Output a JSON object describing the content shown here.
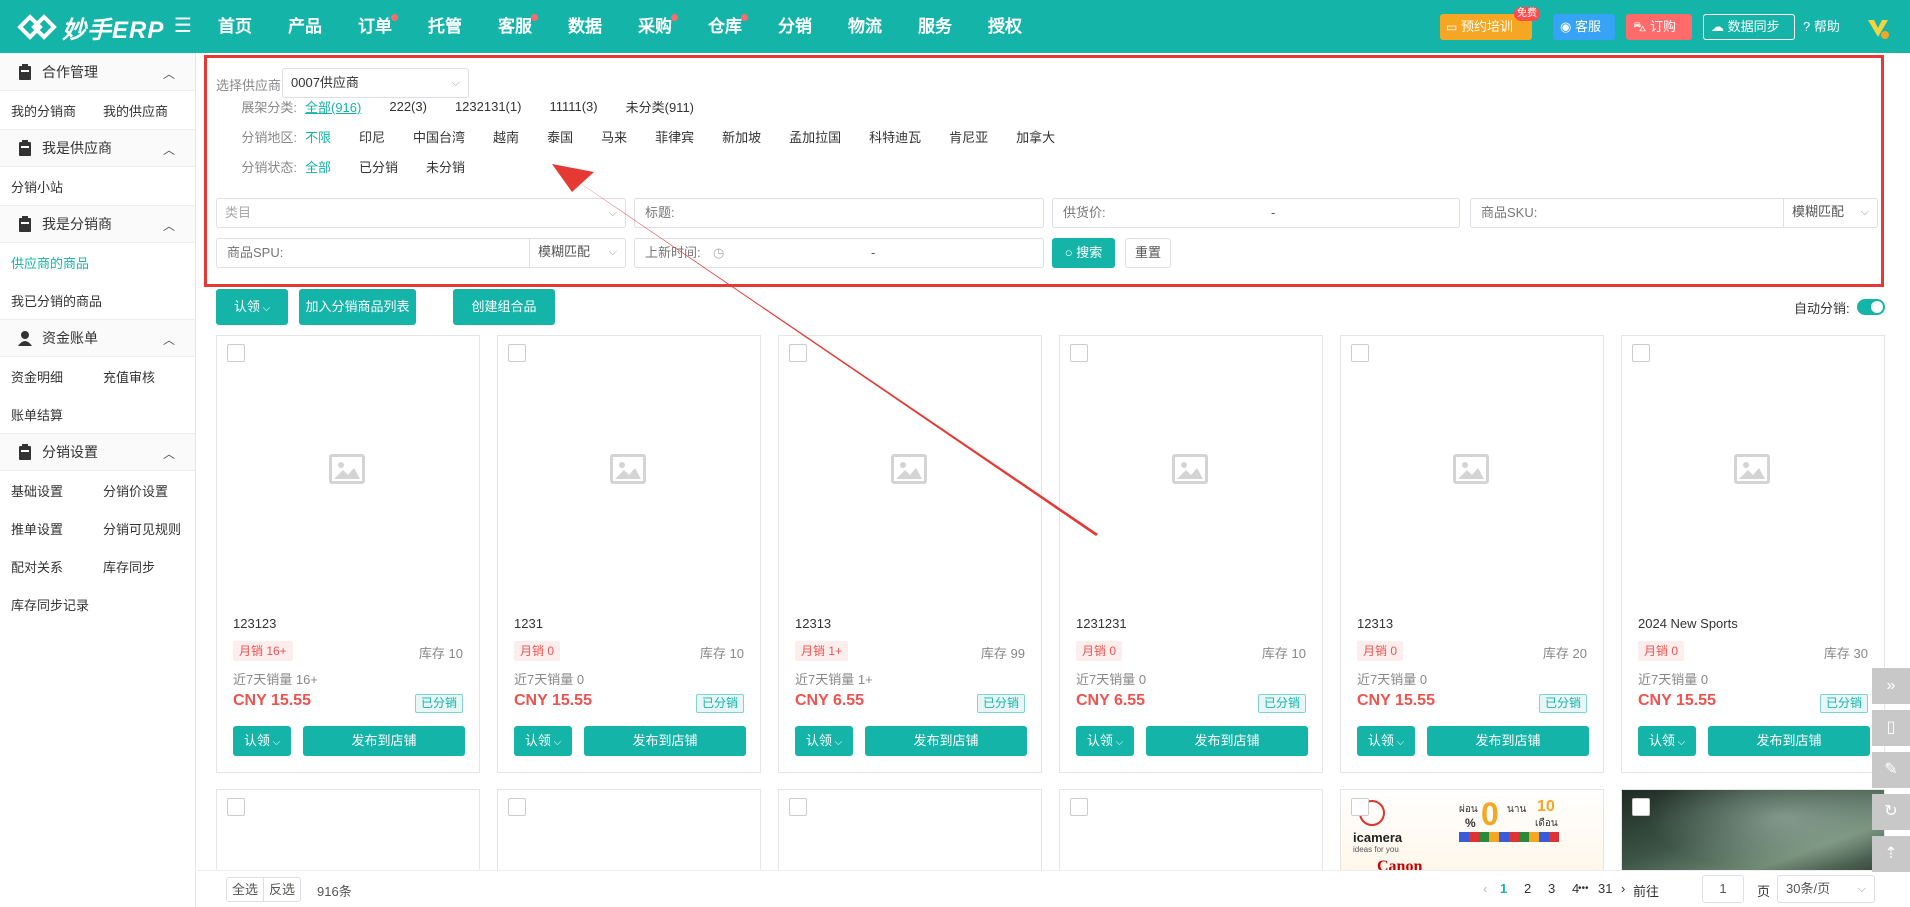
{
  "header": {
    "logo_text": "妙手ERP",
    "nav": [
      {
        "label": "首页",
        "dot": false
      },
      {
        "label": "产品",
        "dot": false
      },
      {
        "label": "订单",
        "dot": true
      },
      {
        "label": "托管",
        "dot": false
      },
      {
        "label": "客服",
        "dot": true
      },
      {
        "label": "数据",
        "dot": false
      },
      {
        "label": "采购",
        "dot": true
      },
      {
        "label": "仓库",
        "dot": true
      },
      {
        "label": "分销",
        "dot": false
      },
      {
        "label": "物流",
        "dot": false
      },
      {
        "label": "服务",
        "dot": false
      },
      {
        "label": "授权",
        "dot": false
      }
    ],
    "training_label": "预约培训",
    "free_badge": "免费",
    "service_label": "客服",
    "order_label": "订购",
    "sync_label": "数据同步",
    "help_label": "帮助",
    "colors": {
      "primary": "#15b4a9",
      "training": "#f5a623",
      "service": "#36a3f7",
      "order": "#ff6b6b"
    }
  },
  "sidebar": {
    "groups": [
      {
        "title": "合作管理",
        "items": [
          [
            "我的分销商",
            "我的供应商"
          ]
        ]
      },
      {
        "title": "我是供应商",
        "items": [
          [
            "分销小站"
          ]
        ]
      },
      {
        "title": "我是分销商",
        "items": [
          [
            "供应商的商品"
          ],
          [
            "我已分销的商品"
          ]
        ]
      },
      {
        "title": "资金账单",
        "items": [
          [
            "资金明细",
            "充值审核"
          ],
          [
            "账单结算"
          ]
        ]
      },
      {
        "title": "分销设置",
        "items": [
          [
            "基础设置",
            "分销价设置"
          ],
          [
            "推单设置",
            "分销可见规则"
          ],
          [
            "配对关系",
            "库存同步"
          ],
          [
            "库存同步记录"
          ]
        ]
      }
    ],
    "active_item": "供应商的商品"
  },
  "filters": {
    "supplier_label": "选择供应商:",
    "supplier_value": "0007供应商",
    "category_label": "展架分类:",
    "categories": [
      "全部(916)",
      "222(3)",
      "1232131(1)",
      "11111(3)",
      "未分类(911)"
    ],
    "region_label": "分销地区:",
    "regions": [
      "不限",
      "印尼",
      "中国台湾",
      "越南",
      "泰国",
      "马来",
      "菲律宾",
      "新加坡",
      "孟加拉国",
      "科特迪瓦",
      "肯尼亚",
      "加拿大"
    ],
    "status_label": "分销状态:",
    "statuses": [
      "全部",
      "已分销",
      "未分销"
    ],
    "category_placeholder": "类目",
    "title_label": "标题:",
    "price_label": "供货价:",
    "range_sep": "-",
    "sku_label": "商品SKU:",
    "match_mode": "模糊匹配",
    "spu_label": "商品SPU:",
    "new_time_label": "上新时间:",
    "clock_icon": "◷",
    "search_label": "搜索",
    "reset_label": "重置"
  },
  "actions": {
    "claim_label": "认领",
    "add_list_label": "加入分销商品列表",
    "create_combo_label": "创建组合品",
    "auto_dist_label": "自动分销:"
  },
  "products": [
    {
      "title": "123123",
      "monthly": "月销 16+",
      "stock": "库存 10",
      "last7": "近7天销量 16+",
      "price": "CNY 15.55",
      "status": "已分销"
    },
    {
      "title": "1231",
      "monthly": "月销 0",
      "stock": "库存 10",
      "last7": "近7天销量 0",
      "price": "CNY 15.55",
      "status": "已分销"
    },
    {
      "title": "12313",
      "monthly": "月销 1+",
      "stock": "库存 99",
      "last7": "近7天销量 1+",
      "price": "CNY 6.55",
      "status": "已分销"
    },
    {
      "title": "1231231",
      "monthly": "月销 0",
      "stock": "库存 10",
      "last7": "近7天销量 0",
      "price": "CNY 6.55",
      "status": "已分销"
    },
    {
      "title": "12313",
      "monthly": "月销 0",
      "stock": "库存 20",
      "last7": "近7天销量 0",
      "price": "CNY 15.55",
      "status": "已分销"
    },
    {
      "title": "2024 New Sports",
      "monthly": "月销 0",
      "stock": "库存 30",
      "last7": "近7天销量 0",
      "price": "CNY 15.55",
      "status": "已分销"
    }
  ],
  "card_buttons": {
    "claim": "认领",
    "publish": "发布到店铺"
  },
  "banner": {
    "brand": "icamera",
    "tagline": "ideas for you",
    "percent": "%",
    "zero": "0",
    "thai1": "ผ่อน",
    "thai2": "นาน",
    "ten": "10",
    "thai3": "เดือน",
    "canon": "Canon"
  },
  "footer": {
    "select_all": "全选",
    "invert": "反选",
    "count": "916条",
    "pages": [
      "1",
      "2",
      "3",
      "4"
    ],
    "ellipsis": "•••",
    "last_page": "31",
    "goto_label": "前往",
    "current_page": "1",
    "page_suffix": "页",
    "page_size": "30条/页"
  },
  "annotation": {
    "color": "#e53935"
  }
}
